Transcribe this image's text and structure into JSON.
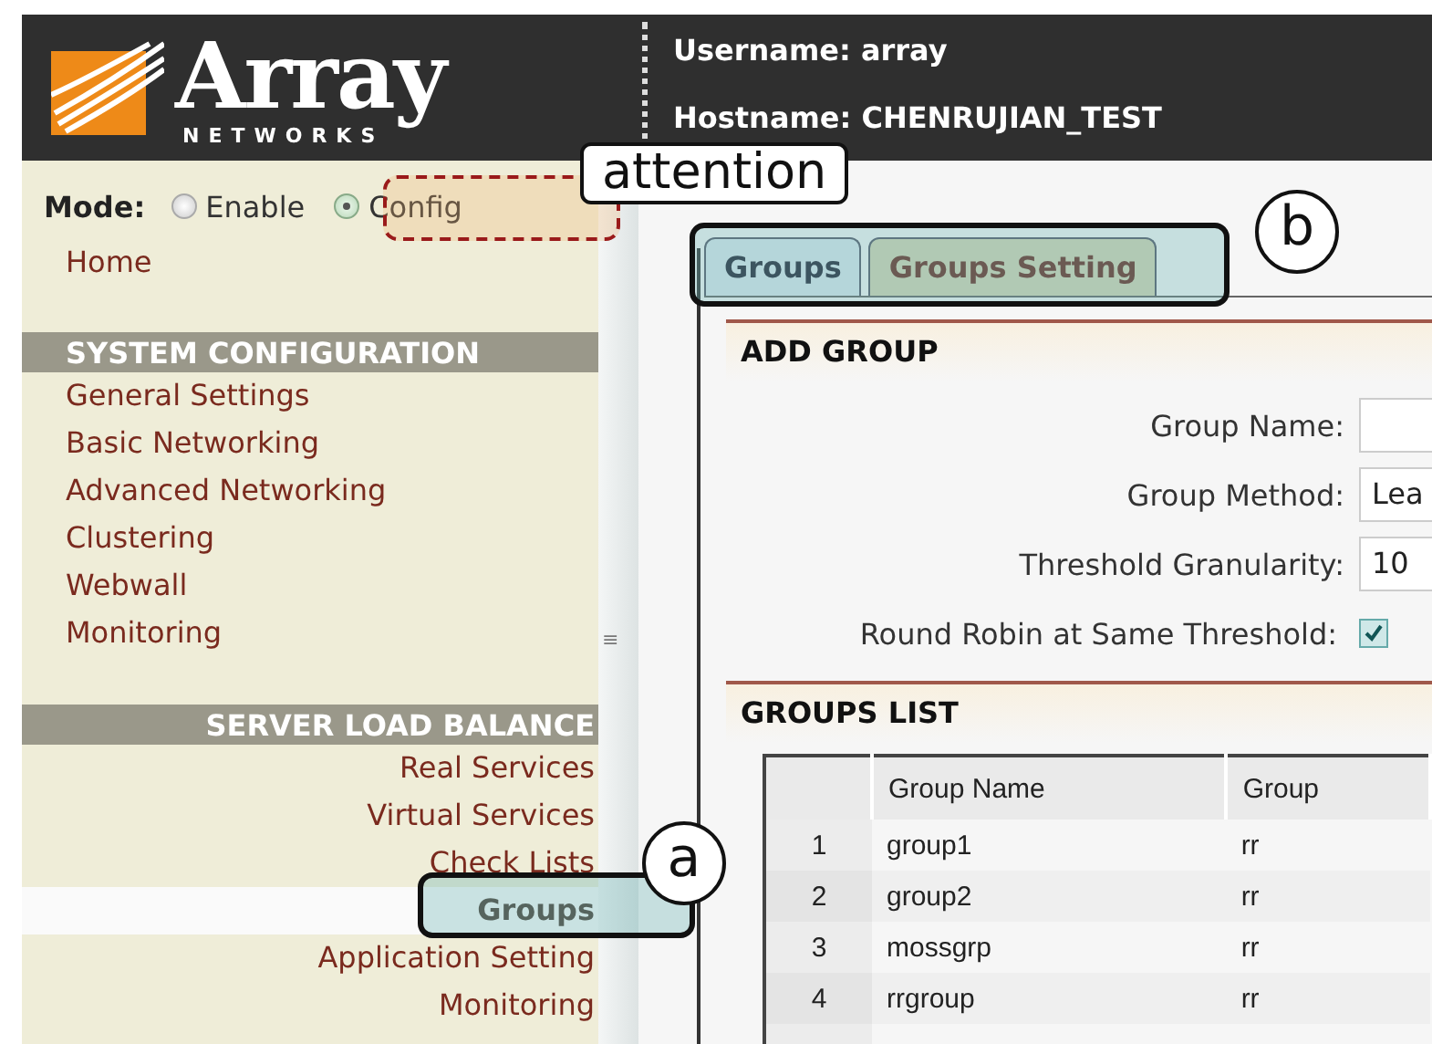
{
  "header": {
    "logo": {
      "name": "Array",
      "tagline": "NETWORKS"
    },
    "username": "Username: array",
    "hostname": "Hostname: CHENRUJIAN_TEST"
  },
  "sidebar": {
    "mode": {
      "label": "Mode:",
      "options": [
        {
          "label": "Enable",
          "selected": false
        },
        {
          "label": "Config",
          "selected": true
        }
      ]
    },
    "home": "Home",
    "sections": [
      {
        "title": "SYSTEM CONFIGURATION",
        "items": [
          {
            "label": "General Settings",
            "selected": false
          },
          {
            "label": "Basic Networking",
            "selected": false
          },
          {
            "label": "Advanced Networking",
            "selected": false
          },
          {
            "label": "Clustering",
            "selected": false
          },
          {
            "label": "Webwall",
            "selected": false
          },
          {
            "label": "Monitoring",
            "selected": false
          }
        ]
      },
      {
        "title": "SERVER LOAD BALANCE",
        "items": [
          {
            "label": "Real Services",
            "selected": false
          },
          {
            "label": "Virtual Services",
            "selected": false
          },
          {
            "label": "Check Lists",
            "selected": false
          },
          {
            "label": "Groups",
            "selected": true
          },
          {
            "label": "Application Setting",
            "selected": false
          },
          {
            "label": "Monitoring",
            "selected": false
          }
        ]
      }
    ]
  },
  "splitter": {
    "grip": "≡"
  },
  "tabs": [
    {
      "label": "Groups",
      "selected": true
    },
    {
      "label": "Groups Setting",
      "selected": false
    }
  ],
  "add_group": {
    "title": "ADD GROUP",
    "fields": [
      {
        "kind": "text",
        "label": "Group Name:"
      },
      {
        "kind": "select",
        "label": "Group Method:",
        "value": "Lea"
      },
      {
        "kind": "text",
        "label": "Threshold Granularity:",
        "value": "10"
      },
      {
        "kind": "checkbox",
        "label": "Round Robin at Same Threshold:",
        "checked": true
      }
    ]
  },
  "groups_list": {
    "title": "GROUPS LIST",
    "columns": [
      "",
      "Group Name",
      "Group"
    ],
    "rows": [
      [
        "1",
        "group1",
        "rr"
      ],
      [
        "2",
        "group2",
        "rr"
      ],
      [
        "3",
        "mossgrp",
        "rr"
      ],
      [
        "4",
        "rrgroup",
        "rr"
      ]
    ]
  },
  "annotations": [
    {
      "kind": "tag",
      "label": "attention"
    },
    {
      "kind": "circle",
      "label": "b"
    },
    {
      "kind": "circle",
      "label": "a"
    }
  ]
}
